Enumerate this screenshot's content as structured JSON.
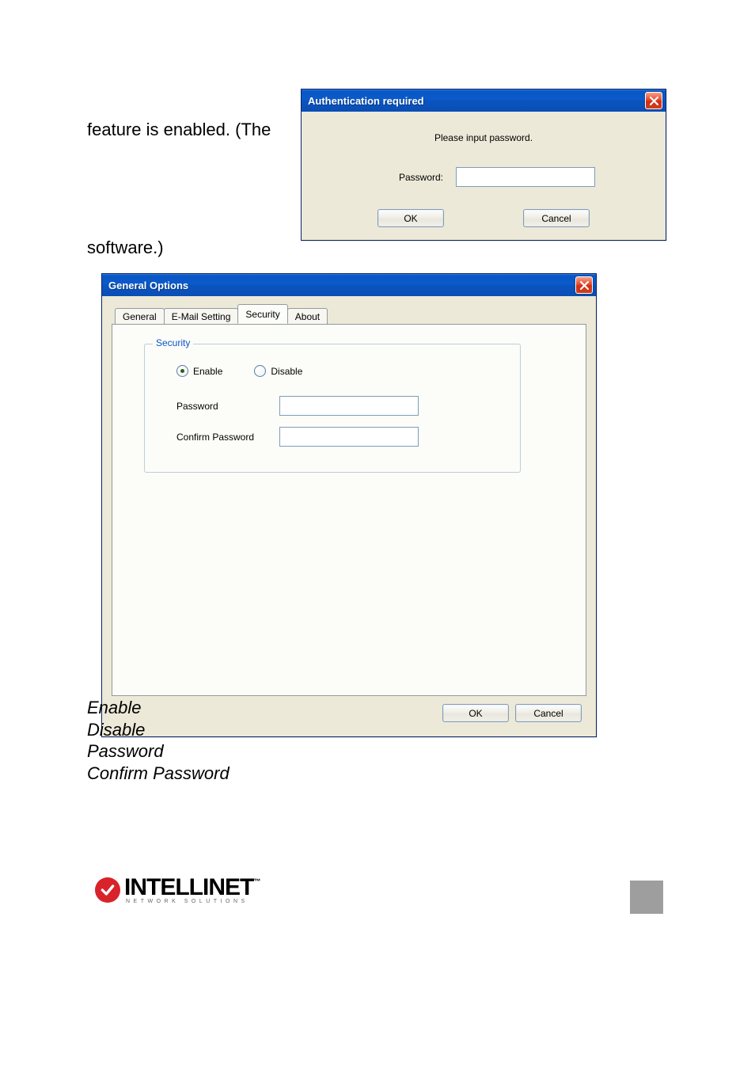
{
  "body_fragments": {
    "f1": "feature is enabled. (The",
    "f2": "software.)"
  },
  "auth_dialog": {
    "title": "Authentication required",
    "message": "Please input password.",
    "password_label": "Password:",
    "password_value": "",
    "ok_label": "OK",
    "cancel_label": "Cancel"
  },
  "options_dialog": {
    "title": "General Options",
    "tabs": {
      "t0": "General",
      "t1": "E-Mail Setting",
      "t2": "Security",
      "t3": "About"
    },
    "active_tab_index": 2,
    "security": {
      "legend": "Security",
      "enable_label": "Enable",
      "disable_label": "Disable",
      "selected": "enable",
      "password_label": "Password",
      "password_value": "",
      "confirm_label": "Confirm Password",
      "confirm_value": ""
    },
    "ok_label": "OK",
    "cancel_label": "Cancel"
  },
  "terms": {
    "t0": "Enable",
    "t1": "Disable",
    "t2": "Password",
    "t3": "Confirm Password"
  },
  "brand": {
    "name": "INTELLINET",
    "tagline": "NETWORK SOLUTIONS"
  }
}
